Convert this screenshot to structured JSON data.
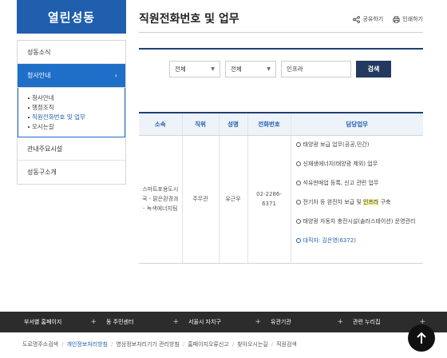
{
  "sidebar": {
    "title": "열린성동",
    "items": [
      {
        "label": "성동소식"
      },
      {
        "label": "청사안내",
        "arrow": "›"
      },
      {
        "label": "관내주요시설"
      },
      {
        "label": "성동구소개"
      }
    ],
    "sub_items": [
      {
        "label": "청사안내"
      },
      {
        "label": "행정조직"
      },
      {
        "label": "직원전화번호 및 업무"
      },
      {
        "label": "오시는길"
      }
    ]
  },
  "header": {
    "title": "직원전화번호 및 업무",
    "share_label": "공유하기",
    "print_label": "인쇄하기"
  },
  "search": {
    "select1": "전체",
    "select2": "전체",
    "keyword": "인프라",
    "button_label": "검색"
  },
  "table": {
    "headers": [
      "소속",
      "직위",
      "성명",
      "전화번호",
      "담당업무"
    ],
    "row": {
      "dept": "스마트포용도시국 - 맑은환경과 - 녹색에너지팀",
      "position": "주무관",
      "name": "유근우",
      "phone": "02-2286-6371",
      "duties": [
        "태양광 보급 업무(공공,민간)",
        "신재생에너지(태양광 제외) 업무",
        "석유판매업 등록, 신고 관련 업무",
        "전기차 등 완전차 보급 및 인프라 구축",
        "태양광 자동차 충전시설(솔라스테이션) 운영관리"
      ],
      "duty4_pre": "전기차 등 완전차 보급 및 ",
      "duty4_hl": "인프라",
      "duty4_post": " 구축",
      "contact": "대직자: 김은영(6372)"
    }
  },
  "footer": {
    "menu": [
      {
        "label": "부서별 홈페이지"
      },
      {
        "label": "동 주민센터"
      },
      {
        "label": "서울시 자치구"
      },
      {
        "label": "유관기관"
      },
      {
        "label": "관련 누리집"
      }
    ],
    "links": [
      "도로명주소검색",
      "개인정보처리방침",
      "영상정보처리기기 관리방침",
      "홈페이지오류신고",
      "찾아오시는길",
      "직원검색"
    ]
  }
}
